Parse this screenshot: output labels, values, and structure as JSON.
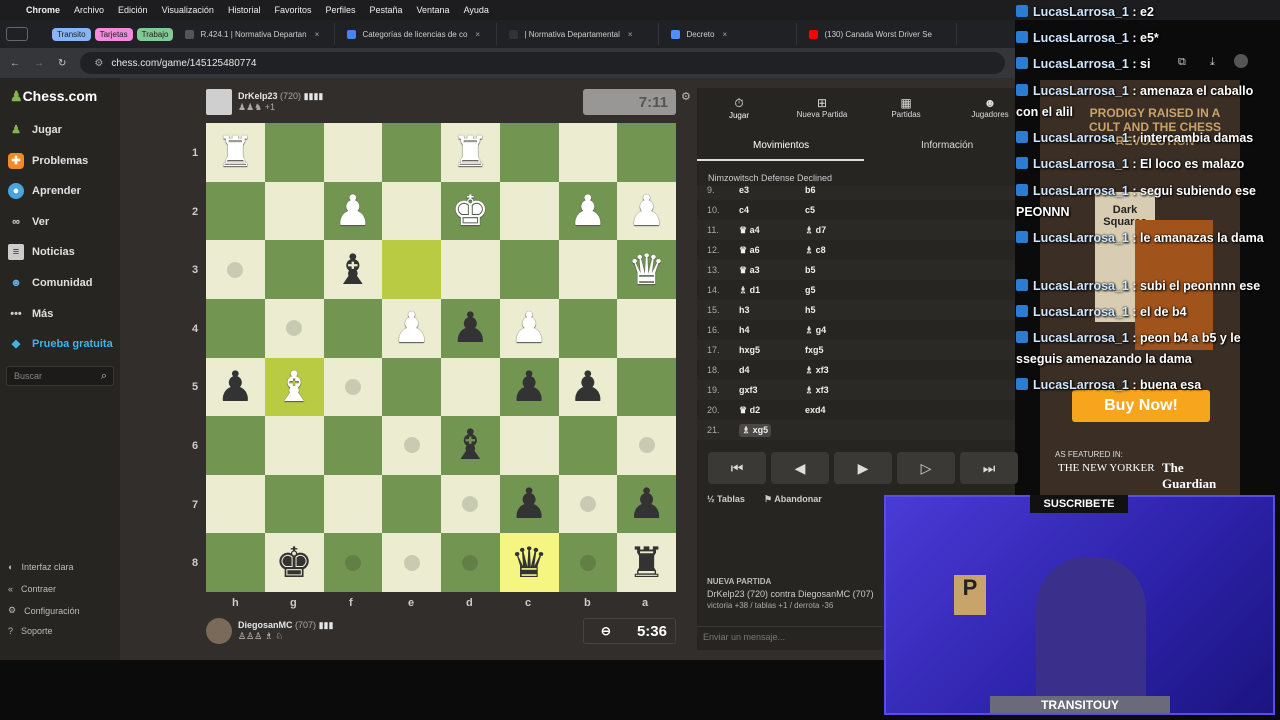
{
  "menubar": {
    "apple": "",
    "app": "Chrome",
    "items": [
      "Archivo",
      "Edición",
      "Visualización",
      "Historial",
      "Favoritos",
      "Perfiles",
      "Pestaña",
      "Ventana",
      "Ayuda"
    ]
  },
  "tabs": {
    "groups": [
      {
        "label": "Transito",
        "color": "#8ab4f8"
      },
      {
        "label": "Tarjetas",
        "color": "#f28bdc"
      },
      {
        "label": "Trabajo",
        "color": "#81c995"
      }
    ],
    "items": [
      {
        "title": "R.424.1 | Normativa Departan",
        "icon_color": "#555555"
      },
      {
        "title": "Categorías de licencias de co",
        "icon_color": "#4285f4"
      },
      {
        "title": "| Normativa Departamental",
        "icon_color": "#333333"
      },
      {
        "title": "Decreto",
        "icon_color": "#4d90fe"
      },
      {
        "title": "(130) Canada Worst Driver Se",
        "icon_color": "#ff0000"
      }
    ]
  },
  "address": {
    "url": "chess.com/game/145125480774"
  },
  "sidebar": {
    "logo": "Chess.com",
    "items": [
      {
        "label": "Jugar",
        "icon": "pawn-icon",
        "color": "#81b64c"
      },
      {
        "label": "Problemas",
        "icon": "puzzle-icon",
        "color": "#f08a24"
      },
      {
        "label": "Aprender",
        "icon": "learn-icon",
        "color": "#4aa3df"
      },
      {
        "label": "Ver",
        "icon": "binoculars-icon",
        "color": "#dddddd"
      },
      {
        "label": "Noticias",
        "icon": "news-icon",
        "color": "#cccccc"
      },
      {
        "label": "Comunidad",
        "icon": "community-icon",
        "color": "#66aadd"
      },
      {
        "label": "Más",
        "icon": "more-icon",
        "color": "#cccccc"
      },
      {
        "label": "Prueba gratuita",
        "icon": "diamond-icon",
        "color": "#3fb4e9"
      }
    ],
    "search_placeholder": "Buscar",
    "bottom": [
      {
        "label": "Interfaz clara",
        "icon": "half-circle-icon"
      },
      {
        "label": "Contraer",
        "icon": "collapse-icon"
      },
      {
        "label": "Configuración",
        "icon": "gear-icon"
      },
      {
        "label": "Soporte",
        "icon": "help-icon"
      }
    ]
  },
  "top_player": {
    "name": "DrKelp23",
    "rating": "(720)",
    "captured": "+1",
    "clock": "7:11"
  },
  "bottom_player": {
    "name": "DiegosanMC",
    "rating": "(707)",
    "clock": "5:36"
  },
  "board": {
    "ranks": [
      "1",
      "2",
      "3",
      "4",
      "5",
      "6",
      "7",
      "8"
    ],
    "files": [
      "h",
      "g",
      "f",
      "e",
      "d",
      "c",
      "b",
      "a"
    ],
    "squares": [
      [
        "wR",
        "",
        "",
        "",
        "wR",
        "",
        "",
        ""
      ],
      [
        "",
        "",
        "wP",
        "",
        "wK",
        "",
        "wP",
        "wP"
      ],
      [
        "dot",
        "",
        "bB",
        "HL",
        "",
        "",
        "",
        "wQ"
      ],
      [
        "",
        "dot",
        "",
        "wP",
        "bP",
        "wP",
        "",
        ""
      ],
      [
        "bP",
        "wB*",
        "dot",
        "",
        "",
        "bP",
        "bP",
        ""
      ],
      [
        "",
        "",
        "",
        "dot",
        "bB",
        "",
        "",
        "dot"
      ],
      [
        "",
        "",
        "",
        "",
        "dot",
        "bP",
        "dot",
        "bP"
      ],
      [
        "",
        "bK",
        "dot",
        "dot",
        "dot",
        "bQ*",
        "dot",
        "bR"
      ]
    ]
  },
  "panel": {
    "tabs": [
      {
        "label": "Jugar",
        "icon": "stopwatch-icon"
      },
      {
        "label": "Nueva Partida",
        "icon": "plus-icon"
      },
      {
        "label": "Partidas",
        "icon": "board-icon"
      },
      {
        "label": "Jugadores",
        "icon": "players-icon"
      }
    ],
    "subtabs": [
      "Movimientos",
      "Información"
    ],
    "opening": "Nimzowitsch Defense Declined",
    "moves": [
      {
        "n": "9.",
        "w": "e3",
        "b": "b6"
      },
      {
        "n": "10.",
        "w": "c4",
        "b": "c5"
      },
      {
        "n": "11.",
        "w": "♛ a4",
        "b": "♗ d7"
      },
      {
        "n": "12.",
        "w": "♛ a6",
        "b": "♗ c8"
      },
      {
        "n": "13.",
        "w": "♛ a3",
        "b": "b5"
      },
      {
        "n": "14.",
        "w": "♗ d1",
        "b": "g5"
      },
      {
        "n": "15.",
        "w": "h3",
        "b": "h5"
      },
      {
        "n": "16.",
        "w": "h4",
        "b": "♗ g4"
      },
      {
        "n": "17.",
        "w": "hxg5",
        "b": "fxg5"
      },
      {
        "n": "18.",
        "w": "d4",
        "b": "♗ xf3"
      },
      {
        "n": "19.",
        "w": "gxf3",
        "b": "♗ xf3"
      },
      {
        "n": "20.",
        "w": "♛ d2",
        "b": "exd4"
      },
      {
        "n": "21.",
        "w": "♗ xg5",
        "b": ""
      }
    ],
    "nav": [
      "⏮",
      "◀",
      "▶",
      "▷",
      "⏭"
    ],
    "draw": "Tablas",
    "resign": "Abandonar",
    "new_game_title": "NUEVA PARTIDA",
    "new_game_line": "DrKelp23 (720) contra DiegosanMC (707)",
    "new_game_stats": "victoria +38 / tablas +1 / derrota -36",
    "chat_placeholder": "Enviar un mensaje..."
  },
  "chat": [
    {
      "user": "LucasLarrosa_1",
      "msg": ": e2"
    },
    {
      "user": "LucasLarrosa_1",
      "msg": ": e5*"
    },
    {
      "user": "LucasLarrosa_1",
      "msg": ": si"
    },
    {
      "user": "LucasLarrosa_1",
      "msg": ": amenaza el caballo con el alil"
    },
    {
      "user": "LucasLarrosa_1",
      "msg": ": intercambia damas"
    },
    {
      "user": "LucasLarrosa_1",
      "msg": ": El loco es malazo"
    },
    {
      "user": "LucasLarrosa_1",
      "msg": ": segui subiendo ese PEONNN"
    },
    {
      "user": "LucasLarrosa_1",
      "msg": ": le amanazas la dama"
    },
    {
      "user": "LucasLarrosa_1",
      "msg": ": subi el peonnnn ese"
    },
    {
      "user": "LucasLarrosa_1",
      "msg": ": el de b4"
    },
    {
      "user": "LucasLarrosa_1",
      "msg": ": peon b4 a b5 y le sseguis amenazando la dama"
    },
    {
      "user": "LucasLarrosa_1",
      "msg": ": buena esa"
    }
  ],
  "ad": {
    "headline": "PRODIGY RAISED IN A CULT AND THE CHESS REVOLUTION",
    "book": "Dark Squares",
    "buy": "Buy Now!",
    "featured": "AS FEATURED IN:",
    "pubs": [
      "THE NEW YORKER",
      "The Guardian"
    ]
  },
  "webcam": {
    "subscribe": "SUSCRIBETE",
    "name": "TRANSITOUY"
  }
}
